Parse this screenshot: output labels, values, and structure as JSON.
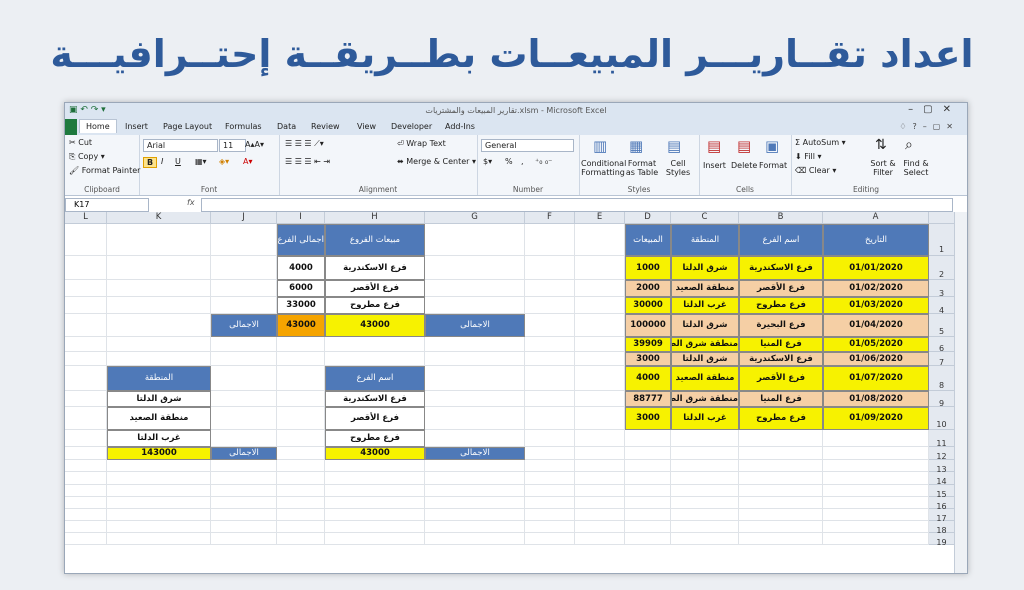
{
  "banner": {
    "title": "اعداد تقــاريـــر المبيعــات بطــريقــة إحتــرافيـــة"
  },
  "window": {
    "title": "تقارير المبيعات والمشتريات.xlsm - Microsoft Excel",
    "tabs": [
      "Home",
      "Insert",
      "Page Layout",
      "Formulas",
      "Data",
      "Review",
      "View",
      "Developer",
      "Add-Ins"
    ]
  },
  "ribbon": {
    "clipboard": {
      "label": "Clipboard",
      "cut": "Cut",
      "copy": "Copy",
      "painter": "Format Painter"
    },
    "font": {
      "label": "Font",
      "name": "Arial",
      "size": "11",
      "bold": "B",
      "italic": "I",
      "underline": "U"
    },
    "alignment": {
      "label": "Alignment",
      "wrap": "Wrap Text",
      "merge": "Merge & Center"
    },
    "number": {
      "label": "Number",
      "format": "General",
      "percent": "%",
      "comma": ","
    },
    "styles": {
      "label": "Styles",
      "cond": "Conditional Formatting",
      "table": "Format as Table",
      "cell": "Cell Styles"
    },
    "cells": {
      "label": "Cells",
      "insert": "Insert",
      "delete": "Delete",
      "format": "Format"
    },
    "editing": {
      "label": "Editing",
      "autosum": "AutoSum",
      "fill": "Fill",
      "clear": "Clear",
      "sort": "Sort & Filter",
      "find": "Find & Select"
    }
  },
  "formula": {
    "namebox": "K17",
    "fx": "fx"
  },
  "columns": [
    "L",
    "K",
    "J",
    "I",
    "H",
    "G",
    "F",
    "E",
    "D",
    "C",
    "B",
    "A"
  ],
  "rows": [
    "1",
    "2",
    "3",
    "4",
    "5",
    "6",
    "7",
    "8",
    "9",
    "10",
    "11",
    "12",
    "13",
    "14",
    "15",
    "16",
    "17",
    "18",
    "19"
  ],
  "main_table": {
    "headers": [
      "التاريخ",
      "اسم الفرع",
      "المنطقة",
      "المبيعات"
    ],
    "rows": [
      [
        "01/01/2020",
        "فرع الاسكندرية",
        "شرق الدلتا",
        "1000"
      ],
      [
        "01/02/2020",
        "فرع الأقصر",
        "منطقة الصعيد",
        "2000"
      ],
      [
        "01/03/2020",
        "فرع مطروح",
        "غرب الدلتا",
        "30000"
      ],
      [
        "01/04/2020",
        "فرع البحيرة",
        "شرق الدلتا",
        "100000"
      ],
      [
        "01/05/2020",
        "فرع المنيا",
        "منطقة شرق الصعيد",
        "39909"
      ],
      [
        "01/06/2020",
        "فرع الاسكندرية",
        "شرق الدلتا",
        "3000"
      ],
      [
        "01/07/2020",
        "فرع الأقصر",
        "منطقة الصعيد",
        "4000"
      ],
      [
        "01/08/2020",
        "فرع المنيا",
        "منطقة شرق الصعيد",
        "88777"
      ],
      [
        "01/09/2020",
        "فرع مطروح",
        "غرب الدلتا",
        "3000"
      ]
    ]
  },
  "branch_summary": {
    "h_header": "مبيعات الفروع",
    "i_header": "اجمالى الفرع",
    "rows": [
      [
        "فرع الاسكندرية",
        "4000"
      ],
      [
        "فرع الأقصر",
        "6000"
      ],
      [
        "فرع مطروح",
        "33000"
      ]
    ],
    "total_label": "الاجمالى",
    "total_h": "43000",
    "total_i": "43000"
  },
  "branch_list": {
    "header": "اسم الفرع",
    "rows": [
      "فرع الاسكندرية",
      "فرع الأقصر",
      "فرع مطروح"
    ],
    "total_label": "الاجمالى",
    "total": "43000"
  },
  "region_list": {
    "header": "المنطقة",
    "rows": [
      "شرق الدلتا",
      "منطقة الصعيد",
      "غرب الدلتا"
    ],
    "total_label": "الاجمالى",
    "total": "143000"
  }
}
